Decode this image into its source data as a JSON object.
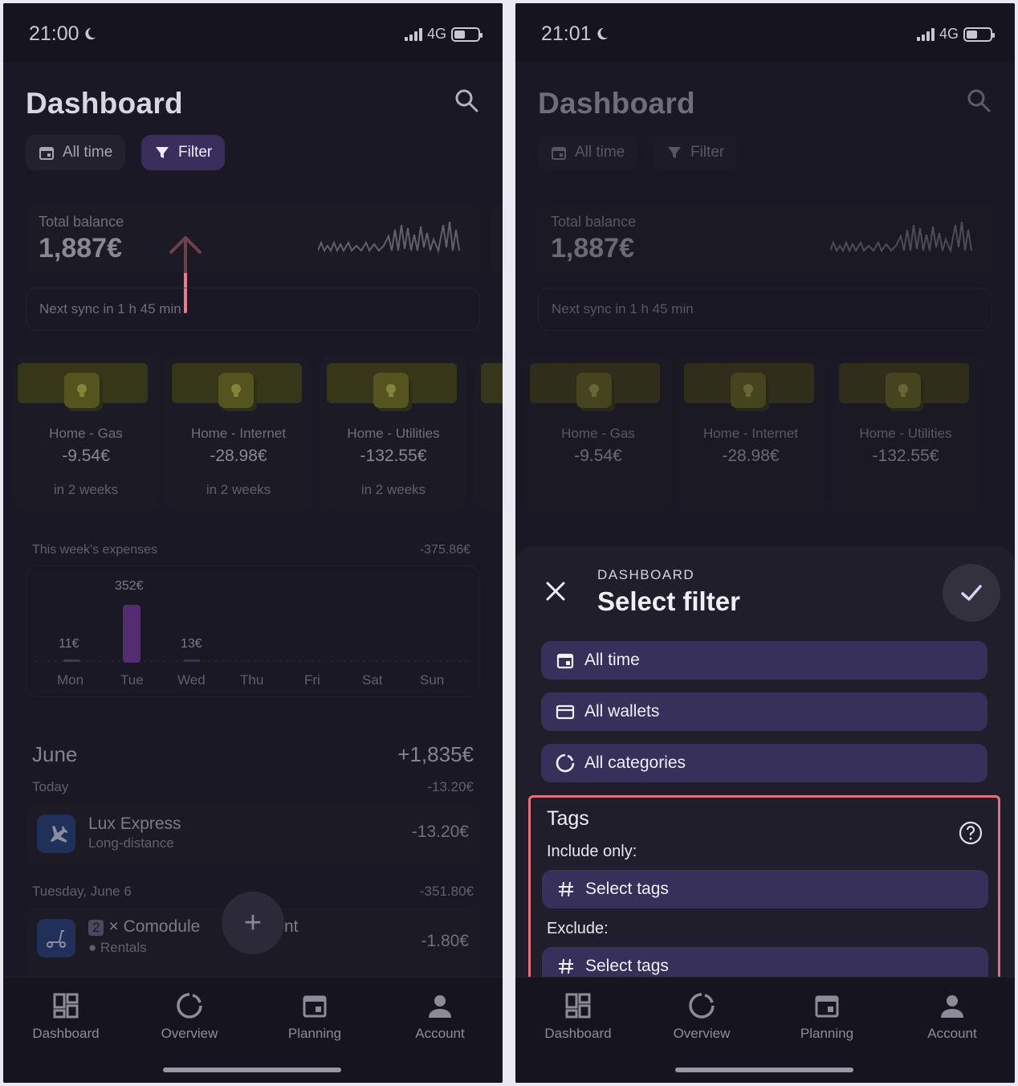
{
  "left": {
    "status": {
      "time": "21:00",
      "network": "4G"
    },
    "header": {
      "title": "Dashboard"
    },
    "chips": {
      "all_time": "All time",
      "filter": "Filter"
    },
    "balance": {
      "label": "Total balance",
      "value": "1,887€"
    },
    "sync": "Next sync in 1 h 45 min",
    "recurring": [
      {
        "name": "Home - Gas",
        "amount": "-9.54€",
        "when": "in 2 weeks"
      },
      {
        "name": "Home - Internet",
        "amount": "-28.98€",
        "when": "in 2 weeks"
      },
      {
        "name": "Home - Utilities",
        "amount": "-132.55€",
        "when": "in 2 weeks"
      }
    ],
    "week": {
      "title": "This week's expenses",
      "total": "-375.86€",
      "bar_labels": [
        "11€",
        "352€",
        "13€"
      ],
      "days": [
        "Mon",
        "Tue",
        "Wed",
        "Thu",
        "Fri",
        "Sat",
        "Sun"
      ]
    },
    "month": {
      "name": "June",
      "total": "+1,835€"
    },
    "groups": [
      {
        "label": "Today",
        "total": "-13.20€"
      },
      {
        "label": "Tuesday, June 6",
        "total": "-351.80€"
      }
    ],
    "transactions": [
      {
        "title": "Lux Express",
        "subtitle": "Long-distance",
        "amount": "-13.20€"
      },
      {
        "count": "2",
        "title": "× Comodule",
        "title_tail": "nt",
        "subtitle": "● Rentals",
        "amount": "-1.80€"
      }
    ],
    "fab": "+"
  },
  "right": {
    "status": {
      "time": "21:01",
      "network": "4G"
    },
    "sheet": {
      "overline": "DASHBOARD",
      "title": "Select filter",
      "buttons": {
        "all_time": "All time",
        "all_wallets": "All wallets",
        "all_categories": "All categories"
      },
      "tags": {
        "title": "Tags",
        "include_label": "Include only:",
        "include_button": "Select tags",
        "exclude_label": "Exclude:",
        "exclude_button": "Select tags"
      }
    }
  },
  "nav": {
    "dashboard": "Dashboard",
    "overview": "Overview",
    "planning": "Planning",
    "account": "Account"
  },
  "colors": {
    "accent": "#3a2f5c",
    "highlight": "#e8707e",
    "arrow": "#f07a86",
    "bar_tue": "#7a3aa0"
  }
}
